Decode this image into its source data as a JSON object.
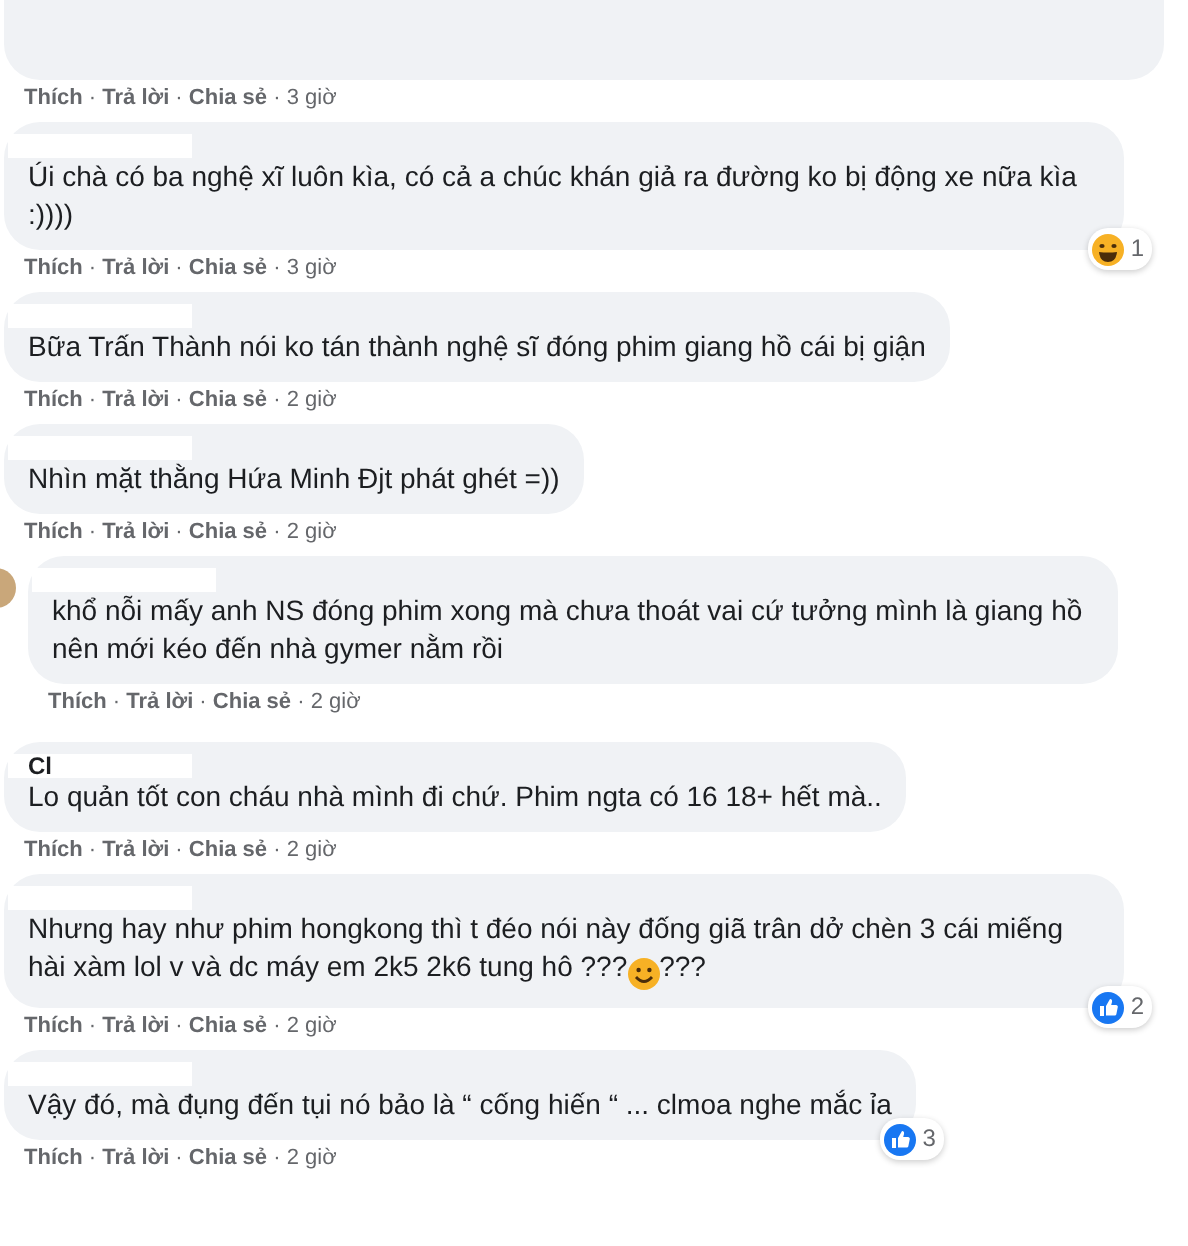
{
  "separator": "·",
  "comments": [
    {
      "kind": "clipped",
      "actions": [
        "Thích",
        "Trả lời",
        "Chia sẻ"
      ],
      "time": "3 giờ"
    },
    {
      "kind": "full",
      "redacted": true,
      "parts": [
        {
          "kind": "text",
          "text": "Úi chà có ba nghệ xĩ luôn kìa, có cả a chúc khán giả ra đường ko bị động xe nữa kìa :))))"
        }
      ],
      "reaction": {
        "kind": "haha",
        "count": "1"
      },
      "actions": [
        "Thích",
        "Trả lời",
        "Chia sẻ"
      ],
      "time": "3 giờ"
    },
    {
      "kind": "full",
      "redacted": true,
      "parts": [
        {
          "kind": "text",
          "text": "Bữa Trấn Thành nói ko tán thành nghệ sĩ đóng phim giang hồ cái bị giận"
        }
      ],
      "actions": [
        "Thích",
        "Trả lời",
        "Chia sẻ"
      ],
      "time": "2 giờ"
    },
    {
      "kind": "full",
      "redacted": true,
      "parts": [
        {
          "kind": "text",
          "text": "Nhìn mặt thằng Hứa Minh Đjt phát ghét =))"
        }
      ],
      "actions": [
        "Thích",
        "Trả lời",
        "Chia sẻ"
      ],
      "time": "2 giờ"
    },
    {
      "kind": "full",
      "redacted": true,
      "avatar": true,
      "parts": [
        {
          "kind": "text",
          "text": "khổ nỗi mấy anh NS đóng phim xong mà chưa thoát vai cứ tưởng mình là giang hồ nên mới kéo đến nhà gymer nằm rồi"
        }
      ],
      "actions": [
        "Thích",
        "Trả lời",
        "Chia sẻ"
      ],
      "time": "2 giờ"
    },
    {
      "kind": "full",
      "redacted": true,
      "name": "Cl",
      "parts": [
        {
          "kind": "text",
          "text": "Lo quản tốt con cháu nhà mình đi chứ. Phim ngta có 16 18+ hết mà.."
        }
      ],
      "actions": [
        "Thích",
        "Trả lời",
        "Chia sẻ"
      ],
      "time": "2 giờ"
    },
    {
      "kind": "full",
      "redacted": true,
      "parts": [
        {
          "kind": "text",
          "text": "Nhưng hay như phim hongkong thì t đéo nói này đống giã trân dở chèn 3 cái miếng hài xàm lol v và dc máy em 2k5 2k6 tung hô ???"
        },
        {
          "kind": "emoji"
        },
        {
          "kind": "text",
          "text": "???"
        }
      ],
      "reaction": {
        "kind": "like",
        "count": "2"
      },
      "actions": [
        "Thích",
        "Trả lời",
        "Chia sẻ"
      ],
      "time": "2 giờ"
    },
    {
      "kind": "full",
      "redacted": true,
      "parts": [
        {
          "kind": "text",
          "text": "Vậy đó, mà đụng đến tụi nó bảo là “ cống hiến “ ... clmoa nghe mắc ỉa"
        }
      ],
      "reaction": {
        "kind": "like",
        "count": "3"
      },
      "actions": [
        "Thích",
        "Trả lời",
        "Chia sẻ"
      ],
      "time": "2 giờ"
    }
  ]
}
